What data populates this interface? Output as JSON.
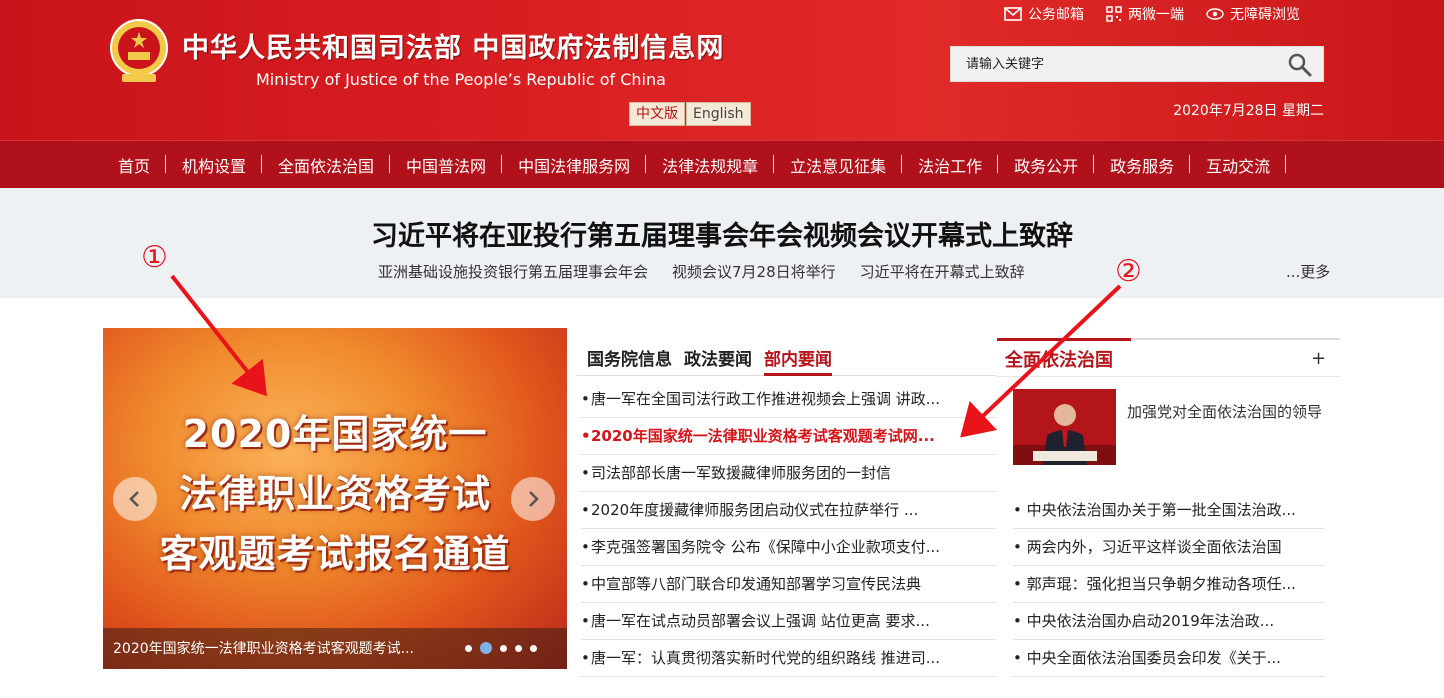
{
  "header": {
    "title_cn": "中华人民共和国司法部  中国政府法制信息网",
    "title_en": "Ministry of Justice of the People’s Republic of China",
    "lang_cn": "中文版",
    "lang_en": "English",
    "toplinks": {
      "mail": "公务邮箱",
      "wechat": "两微一端",
      "accessible": "无障碍浏览"
    },
    "search_placeholder": "请输入关键字",
    "date": "2020年7月28日 星期二"
  },
  "nav": [
    "首页",
    "机构设置",
    "全面依法治国",
    "中国普法网",
    "中国法律服务网",
    "法律法规规章",
    "立法意见征集",
    "法治工作",
    "政务公开",
    "政务服务",
    "互动交流"
  ],
  "headline": {
    "title": "习近平将在亚投行第五届理事会年会视频会议开幕式上致辞",
    "subs": [
      "亚洲基础设施投资银行第五届理事会年会",
      "视频会议7月28日将举行",
      "习近平将在开幕式上致辞"
    ],
    "more": "...更多"
  },
  "carousel": {
    "lines": [
      "2020年国家统一",
      "法律职业资格考试",
      "客观题考试报名通道"
    ],
    "caption": "2020年国家统一法律职业资格考试客观题考试...",
    "dots": 5,
    "active_dot": 1
  },
  "news_tabs": [
    "国务院信息",
    "政法要闻",
    "部内要闻"
  ],
  "news_active_tab": 2,
  "news": [
    "唐一军在全国司法行政工作推进视频会上强调 讲政...",
    "2020年国家统一法律职业资格考试客观题考试网...",
    "司法部部长唐一军致援藏律师服务团的一封信",
    "2020年度援藏律师服务团启动仪式在拉萨举行 ...",
    "李克强签署国务院令 公布《保障中小企业款项支付...",
    "中宣部等八部门联合印发通知部署学习宣传民法典",
    "唐一军在试点动员部署会议上强调 站位更高 要求...",
    "唐一军：认真贯彻落实新时代党的组织路线 推进司..."
  ],
  "right": {
    "tab": "全面依法治国",
    "plus": "+",
    "feature_text": "加强党对全面依法治国的领导",
    "news": [
      "中央依法治国办关于第一批全国法治政...",
      "两会内外，习近平这样谈全面依法治国",
      "郭声琨：强化担当只争朝夕推动各项任...",
      "中央依法治国办启动2019年法治政...",
      "中央全面依法治国委员会印发《关于..."
    ]
  },
  "annotations": {
    "one": "①",
    "two": "②"
  },
  "colors": {
    "brand_red": "#d91e22",
    "nav_red": "#b0111a",
    "band_bg": "#edf1f4",
    "hot_red": "#d4141a",
    "annotation_red": "#e8141a"
  }
}
